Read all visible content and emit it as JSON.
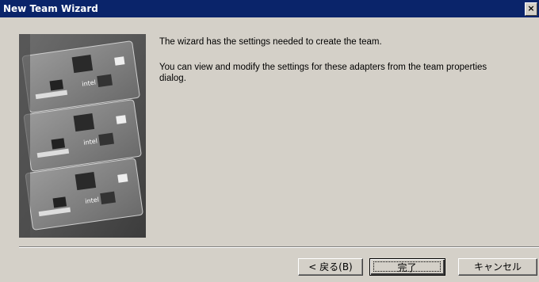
{
  "window": {
    "title": "New Team Wizard",
    "close_label": "×"
  },
  "content": {
    "message_1": "The wizard has the settings needed to create the team.",
    "message_2": "You can view and modify the settings for these adapters from the team properties dialog.",
    "image": "network-adapter-cards-illustration"
  },
  "buttons": {
    "back_label": "< 戻る(B)",
    "finish_label": "完了",
    "cancel_label": "キャンセル"
  },
  "colors": {
    "titlebar": "#0a246a",
    "dialog_bg": "#d4d0c8"
  }
}
